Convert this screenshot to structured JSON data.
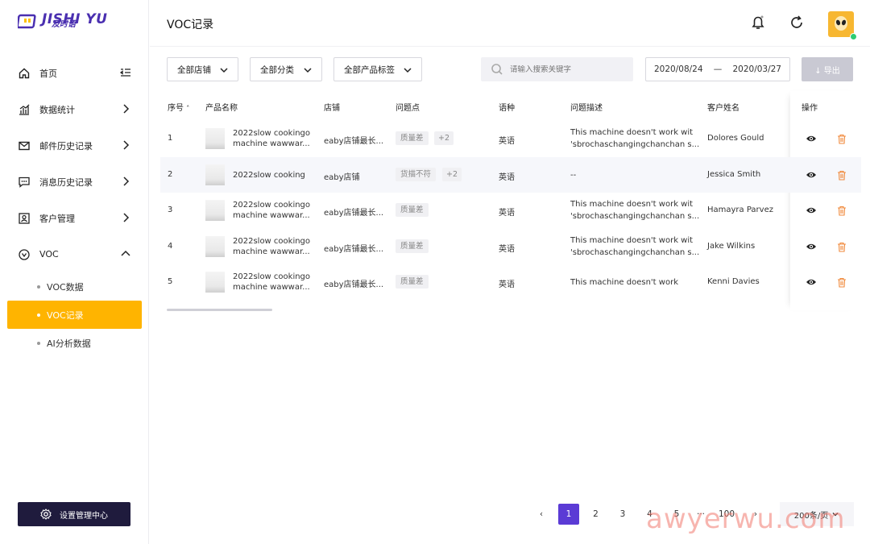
{
  "brand": {
    "name": "JISHI YU",
    "sub": "及时语"
  },
  "sidebar": {
    "items": [
      {
        "label": "首页"
      },
      {
        "label": "数据统计"
      },
      {
        "label": "邮件历史记录"
      },
      {
        "label": "消息历史记录"
      },
      {
        "label": "客户管理"
      },
      {
        "label": "VOC"
      }
    ],
    "voc_sub": [
      {
        "label": "VOC数据"
      },
      {
        "label": "VOC记录"
      },
      {
        "label": "AI分析数据"
      }
    ],
    "settings_label": "设置管理中心"
  },
  "header": {
    "title": "VOC记录"
  },
  "filters": {
    "store": "全部店铺",
    "category": "全部分类",
    "tag": "全部产品标签",
    "search_placeholder": "请输入搜索关键字",
    "date_start": "2020/08/24",
    "date_sep": "—",
    "date_end": "2020/03/27",
    "export": "↓ 导出"
  },
  "table": {
    "columns": [
      "序号",
      "产品名称",
      "店铺",
      "问题点",
      "语种",
      "问题描述",
      "客户姓名",
      "操作"
    ],
    "sort_icon": "˄",
    "rows": [
      {
        "no": "1",
        "name1": "2022slow cookingo",
        "name2": "machine wawwar...",
        "store": "eaby店铺最长...",
        "tag": "质量差",
        "more": "+2",
        "lang": "英语",
        "desc1": "This machine doesn't work wit",
        "desc2": "'sbrochaschangingchanchan s...",
        "customer": "Dolores Gould"
      },
      {
        "no": "2",
        "name1": "2022slow cooking",
        "name2": "",
        "store": "eaby店铺",
        "tag": "货描不符",
        "more": "+2",
        "lang": "英语",
        "desc1": "--",
        "desc2": "",
        "customer": "Jessica Smith"
      },
      {
        "no": "3",
        "name1": "2022slow cookingo",
        "name2": "machine wawwar...",
        "store": "eaby店铺最长...",
        "tag": "质量差",
        "more": "",
        "lang": "英语",
        "desc1": "This machine doesn't work wit",
        "desc2": "'sbrochaschangingchanchan s...",
        "customer": "Hamayra Parvez"
      },
      {
        "no": "4",
        "name1": "2022slow cookingo",
        "name2": "machine wawwar...",
        "store": "eaby店铺最长...",
        "tag": "质量差",
        "more": "",
        "lang": "英语",
        "desc1": "This machine doesn't work wit",
        "desc2": "'sbrochaschangingchanchan s...",
        "customer": "Jake Wilkins"
      },
      {
        "no": "5",
        "name1": "2022slow cookingo",
        "name2": "machine wawwar...",
        "store": "eaby店铺最长...",
        "tag": "质量差",
        "more": "",
        "lang": "英语",
        "desc1": "This machine doesn't work",
        "desc2": "",
        "customer": "Kenni Davies"
      }
    ]
  },
  "pagination": {
    "prev": "‹",
    "pages": [
      "1",
      "2",
      "3",
      "4",
      "5"
    ],
    "ellipsis": "···",
    "last": "100",
    "next": "›",
    "page_size": "200条/页",
    "current": "1"
  },
  "watermark": "awyerwu.com",
  "colors": {
    "accent": "#ffb400",
    "primary": "#5b3bd5",
    "dark": "#1f1b3d",
    "delete": "#f08a3c"
  }
}
